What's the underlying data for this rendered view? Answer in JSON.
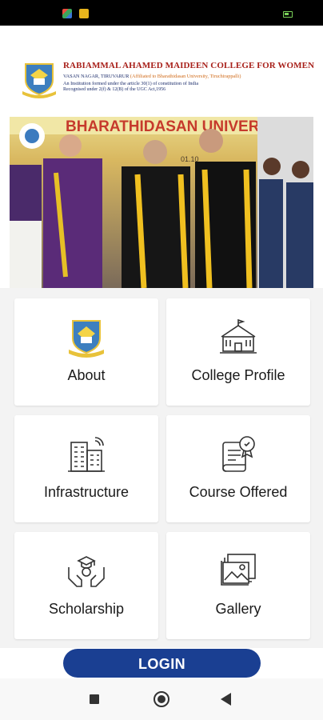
{
  "header": {
    "college_name": "RABIAMMAL AHAMED MAIDEEN COLLEGE FOR WOMEN",
    "address": "VASAN NAGAR, TIRUVARUR",
    "affiliation": "(Affiliated to Bharathidasan University, Tiruchirappalli)",
    "institution_note": "An Institution formed under the article 30(1) of constitution of India",
    "recognition": "Recognised under 2(f) & 12(B) of the UGC Act,1956"
  },
  "hero": {
    "banner_text": "BHARATHIDASAN UNIVERSITY, T",
    "banner_date": "01.10"
  },
  "tiles": [
    {
      "label": "About",
      "icon": "college-logo-icon"
    },
    {
      "label": "College Profile",
      "icon": "college-building-icon"
    },
    {
      "label": "Infrastructure",
      "icon": "building-icon"
    },
    {
      "label": "Course Offered",
      "icon": "certificate-icon"
    },
    {
      "label": "Scholarship",
      "icon": "scholarship-icon"
    },
    {
      "label": "Gallery",
      "icon": "gallery-icon"
    }
  ],
  "login": {
    "label": "LOGIN"
  },
  "colors": {
    "primary": "#1a3f92",
    "title_red": "#a8201a",
    "tile_bg": "#ffffff",
    "grid_bg": "#f3f3f3"
  }
}
